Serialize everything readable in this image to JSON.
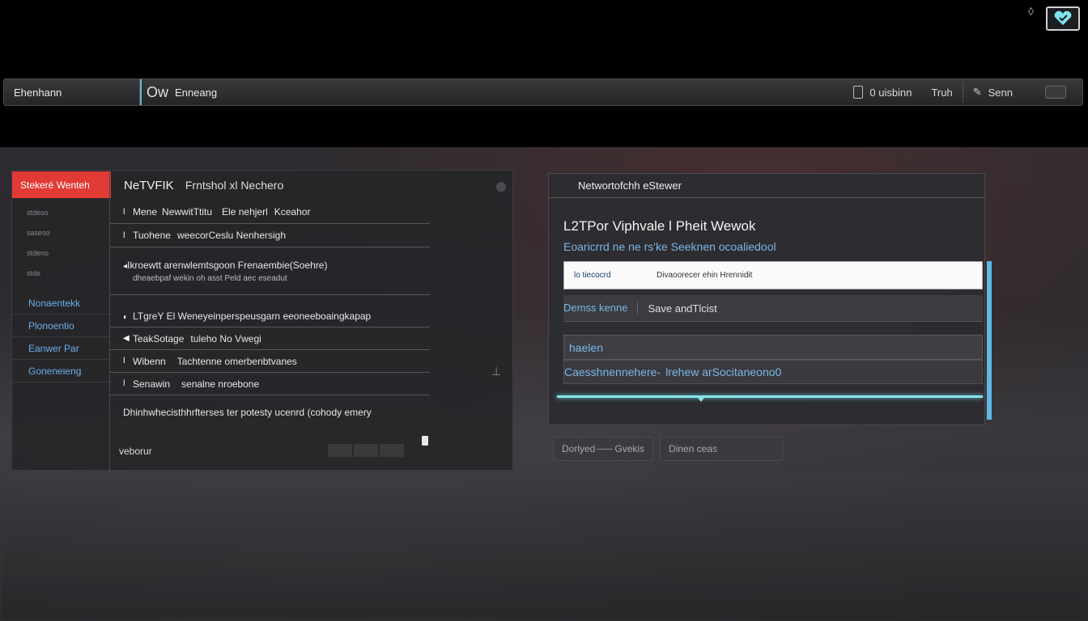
{
  "toolbar": {
    "left_label": "Ehenhann",
    "mid_prefix": "Ow",
    "mid_label": "Enneang",
    "right_label_1": "0 uisbinn",
    "right_label_2": "Truh",
    "right_label_3": "Senn"
  },
  "left_panel": {
    "tab_label": "Stekeré Wenteh",
    "title": "NeTVFIK",
    "title_sub": "Frntshol xl Nechero",
    "nav_small": [
      "stdeso",
      "saseso",
      "stdeno",
      "stde"
    ],
    "nav_links": [
      "Nonaentekk",
      "Plonoentio",
      "Eanwer Par",
      "Goneneieng"
    ],
    "rows": [
      {
        "a": "Mene",
        "b": "NewwitTtitu",
        "c": "Ele nehjerl",
        "d": "Kceahor"
      },
      {
        "a": "Tuohene",
        "b": "weecorCeslu Nenhersigh"
      },
      {
        "a": "Ikroewtt arenwlemtsgoon Frenaembie(Soehre)",
        "l2": "dheaebpaf wekin oh asst   Peld aec  eseadut"
      },
      {
        "a": "LTgreY El Weneyeinperspeusgarn eeoneeboaingkapap"
      },
      {
        "a": "TeakSotage",
        "b": "tuleho No Vwegi"
      },
      {
        "a": "Wibenn",
        "b": "Tachtenne omerbenbtvanes"
      },
      {
        "a": "Senawin",
        "b": "senalne nroebone"
      },
      {
        "a": "Dhinhwhecisthhrfterses ter potesty ucenrd (cohody emery"
      }
    ],
    "footer": "veborur"
  },
  "right_panel": {
    "header": "Networtofchh eStewer",
    "title": "L2TPor Viphvale l Pheit Wewok",
    "subtitle": "Eoaricrrd ne ne rs'ke Seeknen ocoaliedool",
    "input_left": "lo tiecocrd",
    "input_right": "Divaoorecer ehin Hrennidit",
    "action_1": "Demss kenne",
    "action_2": "Save andTlcist",
    "field_value": "haelen",
    "line2_a": "Caesshnennehere-",
    "line2_b": "lrehew arSocitaneono0"
  },
  "bottom_buttons": {
    "left_a": "Dorlyed",
    "left_b": "Gvekis",
    "right": "Dinen ceas"
  }
}
